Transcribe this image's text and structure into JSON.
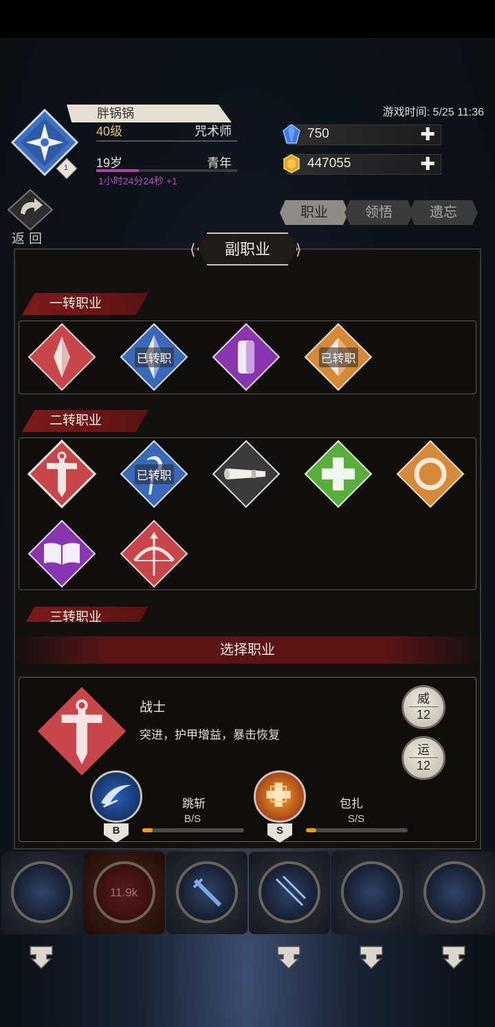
{
  "header": {
    "player_name": "胖锅锅",
    "level": "40级",
    "class": "咒术师",
    "age": "19岁",
    "age_stage": "青年",
    "age_progress": 0.3,
    "timer": "1小时24分24秒 +1",
    "avatar_badge": "1",
    "game_time": "游戏时间: 5/25 11:36"
  },
  "resources": {
    "diamonds": "750",
    "gold": "447055"
  },
  "back_label": "返回",
  "tabs": [
    "职业",
    "领悟",
    "遗忘"
  ],
  "active_tab": "职业",
  "panel": {
    "title": "副职业",
    "tier1": {
      "label": "一转职业",
      "converted_label": "已转职"
    },
    "tier2": {
      "label": "二转职业",
      "converted_label": "已转职"
    },
    "tier3": {
      "label": "三转职业"
    },
    "select_label": "选择职业"
  },
  "selected_class": {
    "name": "战士",
    "desc": "突进，护甲增益，暴击恢复",
    "stats": [
      {
        "label": "威",
        "value": "12"
      },
      {
        "label": "运",
        "value": "12"
      }
    ],
    "skills": [
      {
        "name": "跳斩",
        "rank": "B/S",
        "badge": "B",
        "progress": 0.1
      },
      {
        "name": "包扎",
        "rank": "S/S",
        "badge": "S",
        "progress": 0.1
      }
    ]
  },
  "bottom": {
    "center_value": "11.9k"
  },
  "colors": {
    "red": "#c8454a",
    "blue": "#3a68b8",
    "purple": "#8a35b0",
    "orange": "#d68a38",
    "gray": "#3a3a3a",
    "green": "#58ae3c"
  }
}
